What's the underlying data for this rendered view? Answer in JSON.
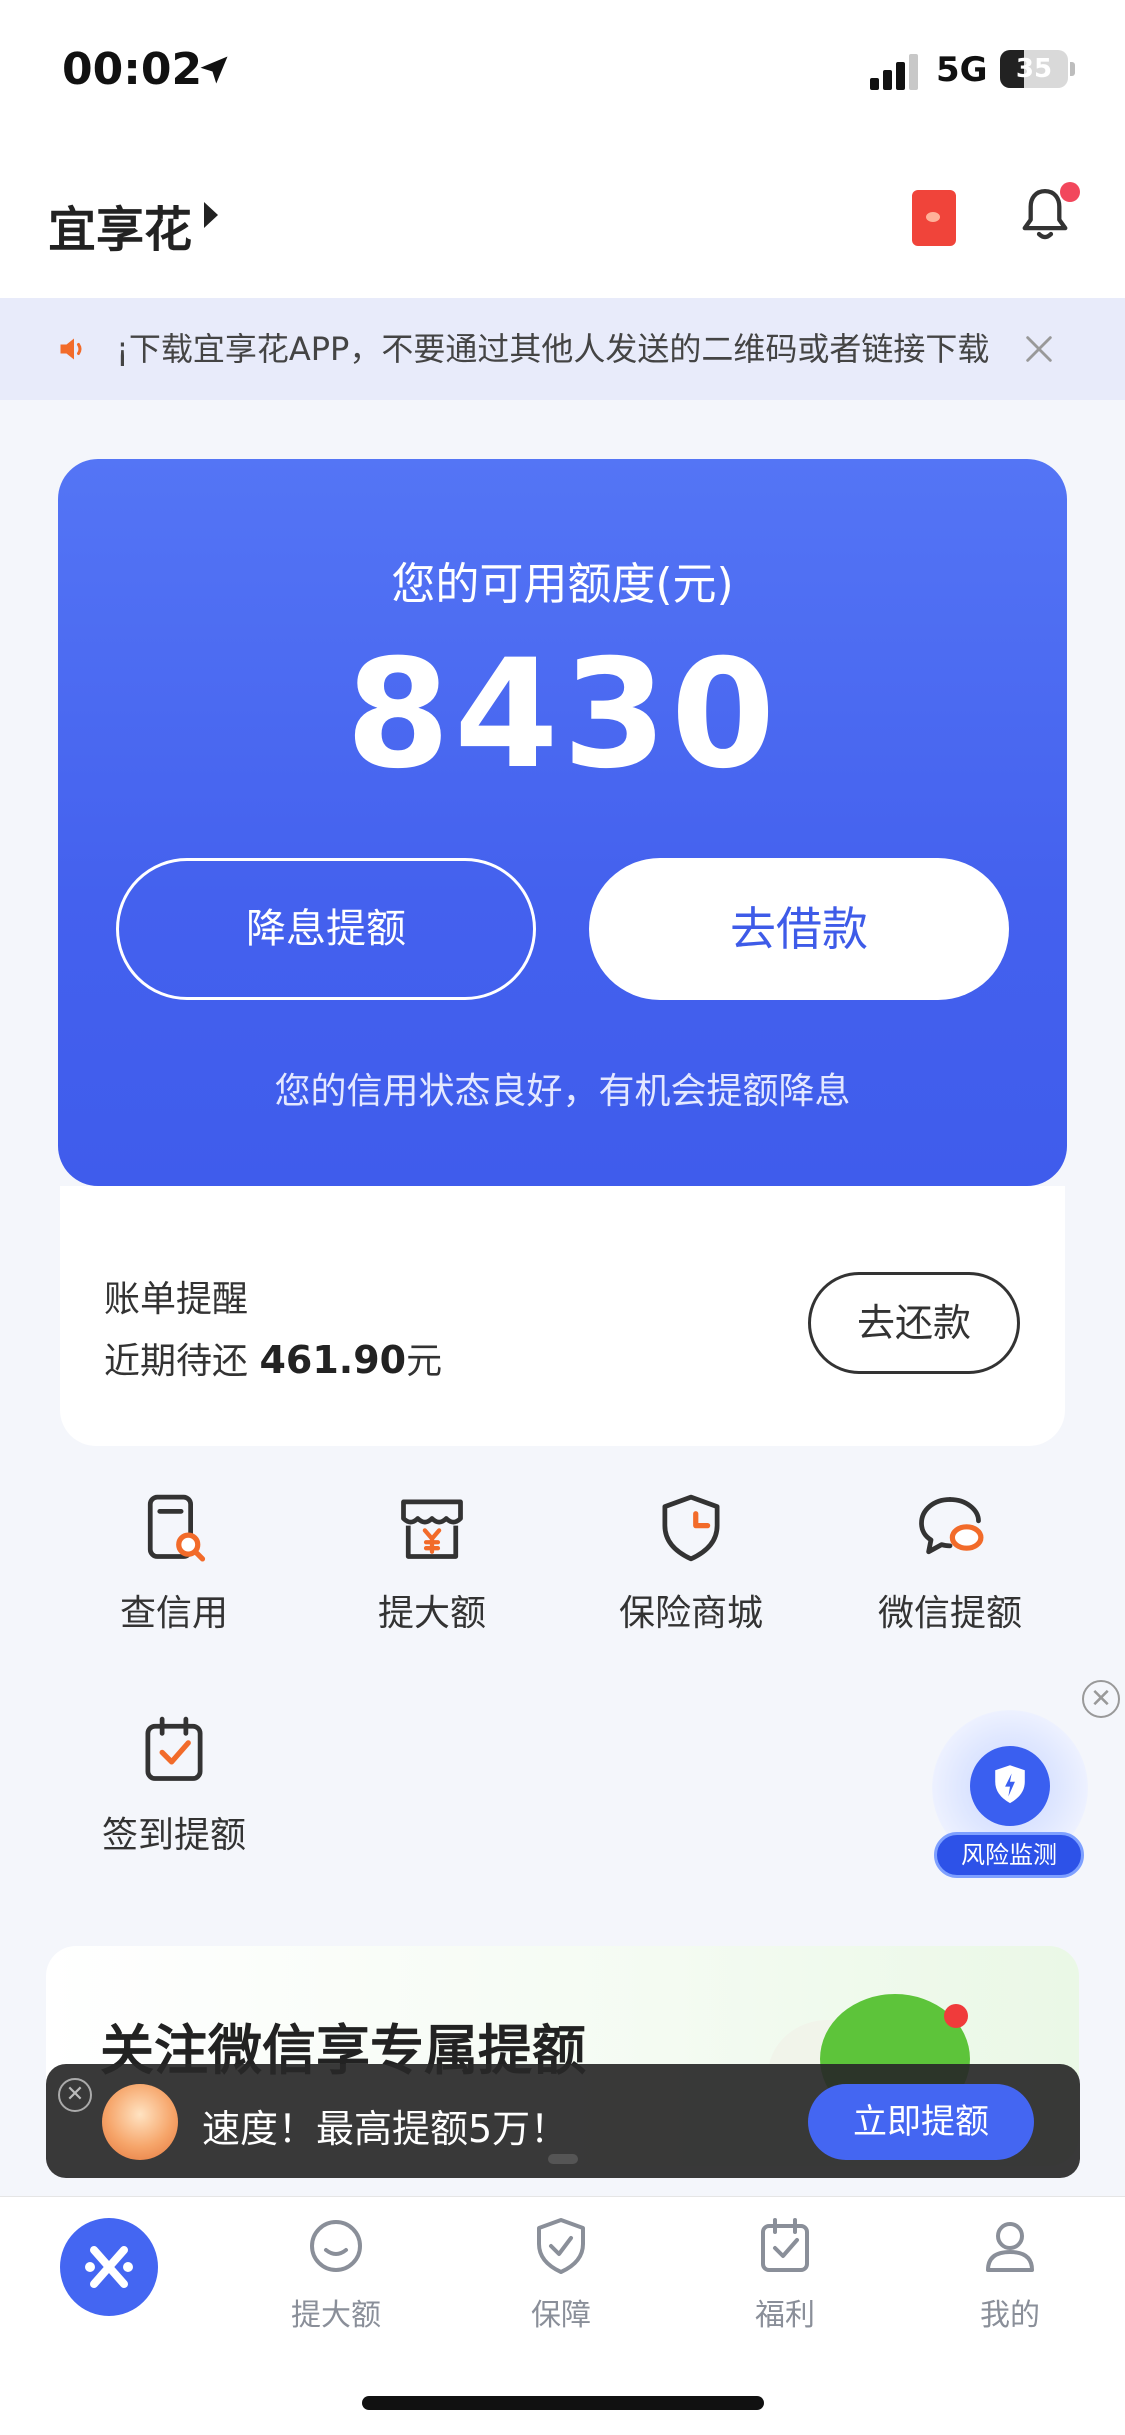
{
  "status_bar": {
    "time": "00:02",
    "network": "5G",
    "battery": "35",
    "battery_level": 0.35
  },
  "header": {
    "title": "宜享花"
  },
  "notice": {
    "text": "¡下载宜享花APP，不要通过其他人发送的二维码或者链接下载"
  },
  "credit_card": {
    "label": "您的可用额度(元)",
    "amount": "8430",
    "reduce_interest_button": "降息提额",
    "borrow_button": "去借款",
    "hint": "您的信用状态良好，有机会提额降息"
  },
  "bill": {
    "title": "账单提醒",
    "due_prefix": "近期待还 ",
    "due_amount": "461.90",
    "due_suffix": "元",
    "repay_button": "去还款"
  },
  "services": [
    {
      "label": "查信用",
      "icon": "credit-check-icon"
    },
    {
      "label": "提大额",
      "icon": "store-yen-icon"
    },
    {
      "label": "保险商城",
      "icon": "shield-icon"
    },
    {
      "label": "微信提额",
      "icon": "chat-bubble-icon"
    },
    {
      "label": "签到提额",
      "icon": "calendar-check-icon"
    }
  ],
  "risk_float": {
    "label": "风险监测"
  },
  "promo": {
    "title": "关注微信享专属提额"
  },
  "toast": {
    "text": "速度！最高提额5万！",
    "button": "立即提额"
  },
  "tabbar": {
    "items": [
      {
        "label": "提大额",
        "icon": "smile-icon"
      },
      {
        "label": "保障",
        "icon": "shield-check-icon"
      },
      {
        "label": "福利",
        "icon": "calendar-icon"
      },
      {
        "label": "我的",
        "icon": "person-icon"
      }
    ]
  },
  "colors": {
    "primary": "#4466F2",
    "card_gradient_top": "#5475F5",
    "accent_orange": "#F26B2A",
    "notice_bg": "#E8EBFA"
  }
}
